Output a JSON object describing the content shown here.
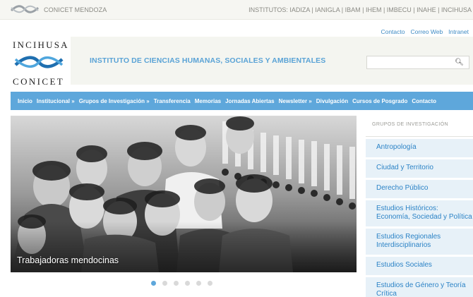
{
  "topbar": {
    "site_label": "CONICET MENDOZA",
    "institutes": "INSTITUTOS: IADIZA | IANIGLA | IBAM | IHEM | IMBECU | INAHE | INCIHUSA"
  },
  "util_links": [
    "Contacto",
    "Correo Web",
    "Intranet"
  ],
  "logo": {
    "top": "INCIHUSA",
    "bottom": "CONICET"
  },
  "header": {
    "title": "INSTITUTO DE CIENCIAS HUMANAS, SOCIALES Y AMBIENTALES"
  },
  "search": {
    "placeholder": "",
    "icon": "search-icon"
  },
  "nav": {
    "items": [
      "Inicio",
      "Institucional »",
      "Grupos de Investigación »",
      "Transferencia",
      "Memorias",
      "Jornadas Abiertas",
      "Newsletter »",
      "Divulgación",
      "Cursos de Posgrado",
      "Contacto"
    ]
  },
  "slider": {
    "caption": "Trabajadoras mendocinas",
    "dots_total": 6,
    "active_dot": 1
  },
  "sidebar": {
    "title": "GRUPOS DE INVESTIGACIÓN",
    "items": [
      "Antropología",
      "Ciudad y Territorio",
      "Derecho Público",
      "Estudios Históricos: Economía, Sociedad y Política",
      "Estudios Regionales Interdisciplinarios",
      "Estudios Sociales",
      "Estudios de Género y Teoría Crítica"
    ]
  },
  "colors": {
    "accent": "#5ea7db",
    "link": "#2c83c6",
    "sidebar_bg": "#e7f1f8"
  }
}
